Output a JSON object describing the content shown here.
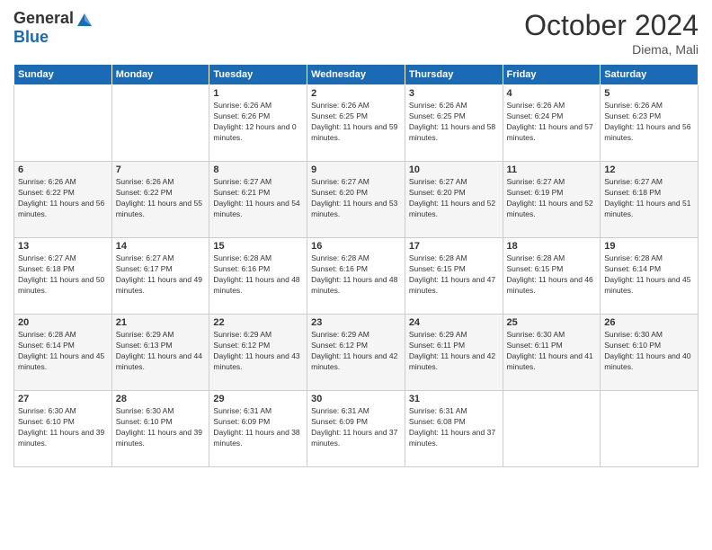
{
  "header": {
    "logo_general": "General",
    "logo_blue": "Blue",
    "month_title": "October 2024",
    "location": "Diema, Mali"
  },
  "days_of_week": [
    "Sunday",
    "Monday",
    "Tuesday",
    "Wednesday",
    "Thursday",
    "Friday",
    "Saturday"
  ],
  "weeks": [
    [
      {
        "day": "",
        "sunrise": "",
        "sunset": "",
        "daylight": ""
      },
      {
        "day": "",
        "sunrise": "",
        "sunset": "",
        "daylight": ""
      },
      {
        "day": "1",
        "sunrise": "Sunrise: 6:26 AM",
        "sunset": "Sunset: 6:26 PM",
        "daylight": "Daylight: 12 hours and 0 minutes."
      },
      {
        "day": "2",
        "sunrise": "Sunrise: 6:26 AM",
        "sunset": "Sunset: 6:25 PM",
        "daylight": "Daylight: 11 hours and 59 minutes."
      },
      {
        "day": "3",
        "sunrise": "Sunrise: 6:26 AM",
        "sunset": "Sunset: 6:25 PM",
        "daylight": "Daylight: 11 hours and 58 minutes."
      },
      {
        "day": "4",
        "sunrise": "Sunrise: 6:26 AM",
        "sunset": "Sunset: 6:24 PM",
        "daylight": "Daylight: 11 hours and 57 minutes."
      },
      {
        "day": "5",
        "sunrise": "Sunrise: 6:26 AM",
        "sunset": "Sunset: 6:23 PM",
        "daylight": "Daylight: 11 hours and 56 minutes."
      }
    ],
    [
      {
        "day": "6",
        "sunrise": "Sunrise: 6:26 AM",
        "sunset": "Sunset: 6:22 PM",
        "daylight": "Daylight: 11 hours and 56 minutes."
      },
      {
        "day": "7",
        "sunrise": "Sunrise: 6:26 AM",
        "sunset": "Sunset: 6:22 PM",
        "daylight": "Daylight: 11 hours and 55 minutes."
      },
      {
        "day": "8",
        "sunrise": "Sunrise: 6:27 AM",
        "sunset": "Sunset: 6:21 PM",
        "daylight": "Daylight: 11 hours and 54 minutes."
      },
      {
        "day": "9",
        "sunrise": "Sunrise: 6:27 AM",
        "sunset": "Sunset: 6:20 PM",
        "daylight": "Daylight: 11 hours and 53 minutes."
      },
      {
        "day": "10",
        "sunrise": "Sunrise: 6:27 AM",
        "sunset": "Sunset: 6:20 PM",
        "daylight": "Daylight: 11 hours and 52 minutes."
      },
      {
        "day": "11",
        "sunrise": "Sunrise: 6:27 AM",
        "sunset": "Sunset: 6:19 PM",
        "daylight": "Daylight: 11 hours and 52 minutes."
      },
      {
        "day": "12",
        "sunrise": "Sunrise: 6:27 AM",
        "sunset": "Sunset: 6:18 PM",
        "daylight": "Daylight: 11 hours and 51 minutes."
      }
    ],
    [
      {
        "day": "13",
        "sunrise": "Sunrise: 6:27 AM",
        "sunset": "Sunset: 6:18 PM",
        "daylight": "Daylight: 11 hours and 50 minutes."
      },
      {
        "day": "14",
        "sunrise": "Sunrise: 6:27 AM",
        "sunset": "Sunset: 6:17 PM",
        "daylight": "Daylight: 11 hours and 49 minutes."
      },
      {
        "day": "15",
        "sunrise": "Sunrise: 6:28 AM",
        "sunset": "Sunset: 6:16 PM",
        "daylight": "Daylight: 11 hours and 48 minutes."
      },
      {
        "day": "16",
        "sunrise": "Sunrise: 6:28 AM",
        "sunset": "Sunset: 6:16 PM",
        "daylight": "Daylight: 11 hours and 48 minutes."
      },
      {
        "day": "17",
        "sunrise": "Sunrise: 6:28 AM",
        "sunset": "Sunset: 6:15 PM",
        "daylight": "Daylight: 11 hours and 47 minutes."
      },
      {
        "day": "18",
        "sunrise": "Sunrise: 6:28 AM",
        "sunset": "Sunset: 6:15 PM",
        "daylight": "Daylight: 11 hours and 46 minutes."
      },
      {
        "day": "19",
        "sunrise": "Sunrise: 6:28 AM",
        "sunset": "Sunset: 6:14 PM",
        "daylight": "Daylight: 11 hours and 45 minutes."
      }
    ],
    [
      {
        "day": "20",
        "sunrise": "Sunrise: 6:28 AM",
        "sunset": "Sunset: 6:14 PM",
        "daylight": "Daylight: 11 hours and 45 minutes."
      },
      {
        "day": "21",
        "sunrise": "Sunrise: 6:29 AM",
        "sunset": "Sunset: 6:13 PM",
        "daylight": "Daylight: 11 hours and 44 minutes."
      },
      {
        "day": "22",
        "sunrise": "Sunrise: 6:29 AM",
        "sunset": "Sunset: 6:12 PM",
        "daylight": "Daylight: 11 hours and 43 minutes."
      },
      {
        "day": "23",
        "sunrise": "Sunrise: 6:29 AM",
        "sunset": "Sunset: 6:12 PM",
        "daylight": "Daylight: 11 hours and 42 minutes."
      },
      {
        "day": "24",
        "sunrise": "Sunrise: 6:29 AM",
        "sunset": "Sunset: 6:11 PM",
        "daylight": "Daylight: 11 hours and 42 minutes."
      },
      {
        "day": "25",
        "sunrise": "Sunrise: 6:30 AM",
        "sunset": "Sunset: 6:11 PM",
        "daylight": "Daylight: 11 hours and 41 minutes."
      },
      {
        "day": "26",
        "sunrise": "Sunrise: 6:30 AM",
        "sunset": "Sunset: 6:10 PM",
        "daylight": "Daylight: 11 hours and 40 minutes."
      }
    ],
    [
      {
        "day": "27",
        "sunrise": "Sunrise: 6:30 AM",
        "sunset": "Sunset: 6:10 PM",
        "daylight": "Daylight: 11 hours and 39 minutes."
      },
      {
        "day": "28",
        "sunrise": "Sunrise: 6:30 AM",
        "sunset": "Sunset: 6:10 PM",
        "daylight": "Daylight: 11 hours and 39 minutes."
      },
      {
        "day": "29",
        "sunrise": "Sunrise: 6:31 AM",
        "sunset": "Sunset: 6:09 PM",
        "daylight": "Daylight: 11 hours and 38 minutes."
      },
      {
        "day": "30",
        "sunrise": "Sunrise: 6:31 AM",
        "sunset": "Sunset: 6:09 PM",
        "daylight": "Daylight: 11 hours and 37 minutes."
      },
      {
        "day": "31",
        "sunrise": "Sunrise: 6:31 AM",
        "sunset": "Sunset: 6:08 PM",
        "daylight": "Daylight: 11 hours and 37 minutes."
      },
      {
        "day": "",
        "sunrise": "",
        "sunset": "",
        "daylight": ""
      },
      {
        "day": "",
        "sunrise": "",
        "sunset": "",
        "daylight": ""
      }
    ]
  ]
}
